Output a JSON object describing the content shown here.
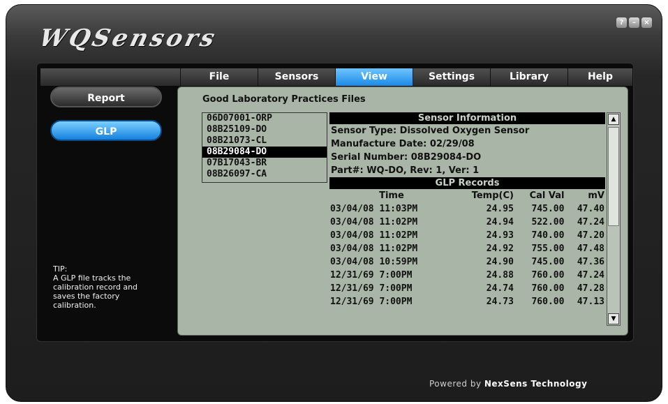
{
  "app": {
    "logo": "WQSensors"
  },
  "window_controls": [
    {
      "name": "help-icon",
      "glyph": "?"
    },
    {
      "name": "minimize-icon",
      "glyph": "–"
    },
    {
      "name": "close-icon",
      "glyph": "×"
    }
  ],
  "menu": {
    "items": [
      "File",
      "Sensors",
      "View",
      "Settings",
      "Library",
      "Help"
    ],
    "active": "View"
  },
  "sidebar": {
    "buttons": [
      "Report",
      "GLP"
    ],
    "active": "GLP",
    "tip_title": "TIP:",
    "tip_text": "A GLP file tracks the calibration record and saves the factory calibration."
  },
  "glp": {
    "title": "Good Laboratory Practices Files",
    "files": [
      "06D07001-ORP",
      "08B25109-DO",
      "08B21073-CL",
      "08B29084-DO",
      "07B17043-BR",
      "08B26097-CA"
    ],
    "selected_file": "08B29084-DO",
    "sensor_info_heading": "Sensor Information",
    "sensor_type": "Sensor Type: Dissolved Oxygen Sensor",
    "manufacture_date": "Manufacture Date: 02/29/08",
    "serial_number": "Serial Number: 08B29084-DO",
    "part": "Part#: WQ-DO, Rev: 1, Ver: 1",
    "records_heading": "GLP Records",
    "columns": [
      "Time",
      "Temp(C)",
      "Cal Val",
      "mV"
    ],
    "records": [
      {
        "time": "03/04/08 11:03PM",
        "temp": "24.95",
        "cal": "745.00",
        "mv": "47.40"
      },
      {
        "time": "03/04/08 11:02PM",
        "temp": "24.94",
        "cal": "522.00",
        "mv": "47.24"
      },
      {
        "time": "03/04/08 11:02PM",
        "temp": "24.93",
        "cal": "740.00",
        "mv": "47.20"
      },
      {
        "time": "03/04/08 11:02PM",
        "temp": "24.92",
        "cal": "755.00",
        "mv": "47.48"
      },
      {
        "time": "03/04/08 10:59PM",
        "temp": "24.90",
        "cal": "745.00",
        "mv": "47.36"
      },
      {
        "time": "12/31/69 7:00PM",
        "temp": "24.88",
        "cal": "760.00",
        "mv": "47.24"
      },
      {
        "time": "12/31/69 7:00PM",
        "temp": "24.74",
        "cal": "760.00",
        "mv": "47.28"
      },
      {
        "time": "12/31/69 7:00PM",
        "temp": "24.73",
        "cal": "760.00",
        "mv": "47.13"
      }
    ]
  },
  "footer": {
    "prefix": "Powered by ",
    "brand": "NexSens Technology"
  }
}
